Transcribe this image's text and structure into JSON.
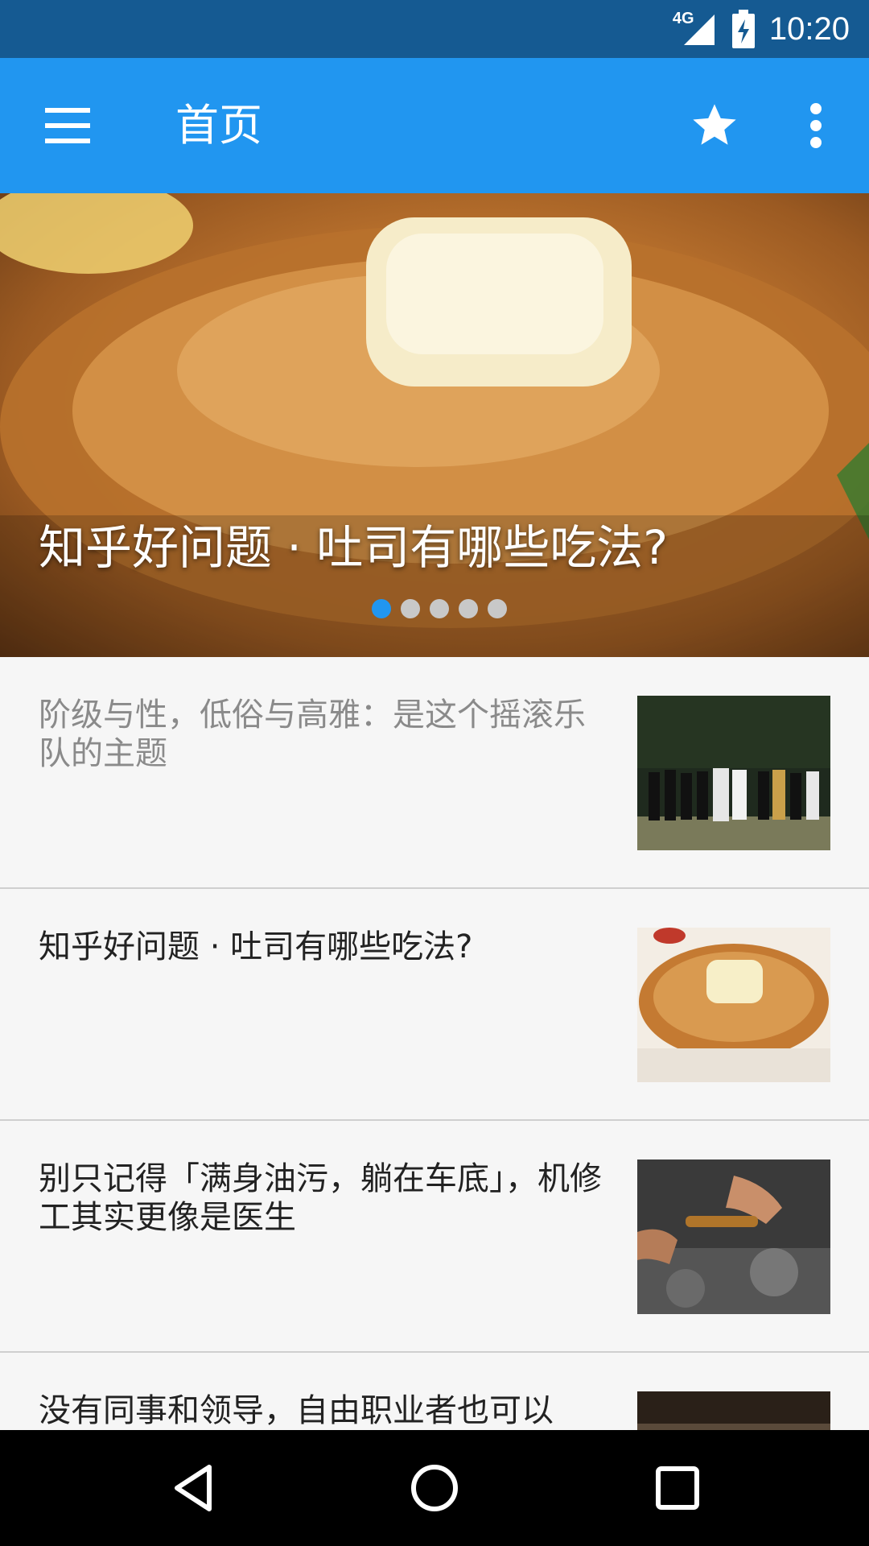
{
  "status_bar": {
    "network": "4G",
    "time": "10:20"
  },
  "app_bar": {
    "title": "首页",
    "icons": [
      "menu-icon",
      "star-icon",
      "more-vert-icon"
    ]
  },
  "banner": {
    "title": "知乎好问题 · 吐司有哪些吃法?",
    "page_count": 5,
    "active_page": 1
  },
  "feed": {
    "items": [
      {
        "title": "阶级与性，低俗与高雅：是这个摇滚乐队的主题",
        "read": true,
        "thumbnail": "group-photo"
      },
      {
        "title": "知乎好问题 · 吐司有哪些吃法?",
        "read": false,
        "thumbnail": "french-toast-photo"
      },
      {
        "title": "别只记得「满身油污，躺在车底」，机修工其实更像是医生",
        "read": false,
        "thumbnail": "engine-repair-photo"
      },
      {
        "title": "没有同事和领导，自由职业者也可以",
        "read": false,
        "thumbnail": "portrait-photo"
      }
    ]
  },
  "nav_bar": {
    "icons": [
      "back-icon",
      "home-icon",
      "recents-icon"
    ]
  },
  "colors": {
    "app_bar": "#2196f0",
    "status_bar": "#155a92",
    "accent_dot": "#2196f0",
    "background": "#f6f6f6"
  }
}
